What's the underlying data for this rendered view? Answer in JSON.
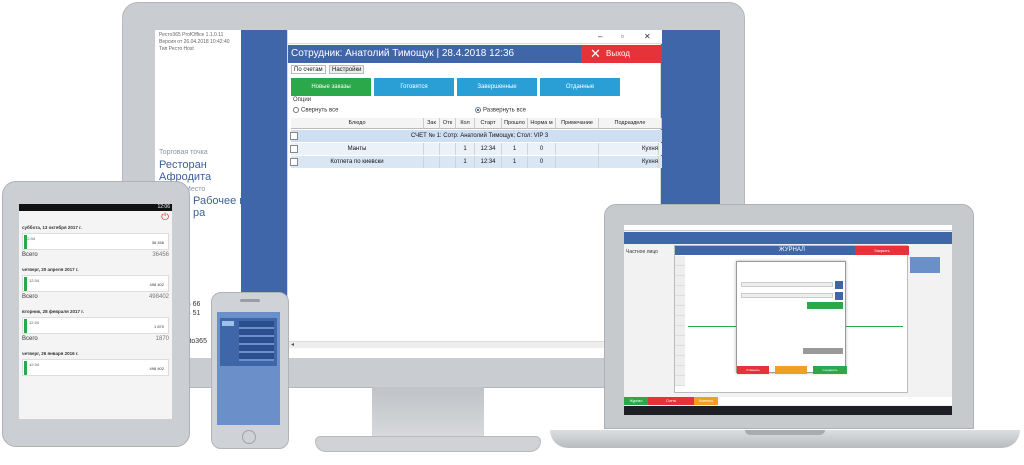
{
  "monitor": {
    "info_lines": [
      "Ресто365 ProfOffice 1.1.0.11",
      "Версия от 26.04.2018 10:42:40",
      "Тип Ресто Host"
    ],
    "store_label": "Торговая точка",
    "store_name_1": "Ресторан",
    "store_name_2": "Афродита",
    "place_label": "Место",
    "place_text": "Рабочее место",
    "place_text2": "ра",
    "phones": [
      "1 26 66",
      "0 84 51"
    ],
    "site": "Resto365",
    "app": {
      "header": "Сотрудник: Анатолий Тимощук | 28.4.2018 12:36",
      "exit_label": "Выход",
      "tabs": [
        "По счетам",
        "Настройки"
      ],
      "order_buttons": [
        {
          "label": "Новые заказы",
          "color": "#2ba84a"
        },
        {
          "label": "Готовятся",
          "color": "#2a9fd6"
        },
        {
          "label": "Завершенные",
          "color": "#2a9fd6"
        },
        {
          "label": "Отданные",
          "color": "#2a9fd6"
        }
      ],
      "options_label": "Опции",
      "collapse_all": "Свернуть все",
      "expand_all": "Развернуть все",
      "columns": [
        "Блюдо",
        "Зак",
        "Отк",
        "Кол",
        "Старт",
        "Прошло",
        "Норма м",
        "Примечание",
        "Подразделе"
      ],
      "group_row": "СЧЕТ № 1: Сотр: Анатолий Тимощук; Стол: VIP 3",
      "rows": [
        {
          "dish": "Манты",
          "qty": "1",
          "start": "12:34",
          "elapsed": "1",
          "norm": "0",
          "dept": "Кухня"
        },
        {
          "dish": "Котлета по киевски",
          "qty": "1",
          "start": "12:34",
          "elapsed": "1",
          "norm": "0",
          "dept": "Кухня"
        }
      ]
    }
  },
  "tablet": {
    "status_time": "12:06",
    "groups": [
      {
        "date": "суббота, 13 октября 2017 г.",
        "card_time": "12:34",
        "card_amount": "36 456",
        "total_label": "Всего",
        "total": "36456"
      },
      {
        "date": "четверг, 20 апреля 2017 г.",
        "card_time": "12:34",
        "card_amount": "498 402",
        "total_label": "Всего",
        "total": "498402"
      },
      {
        "date": "вторник, 28 февраля 2017 г.",
        "card_time": "12:34",
        "card_amount": "1 870",
        "total_label": "Всего",
        "total": "1870"
      },
      {
        "date": "четверг, 26 января 2016 г.",
        "card_time": "12:34",
        "card_amount": "498 402",
        "total_label": "",
        "total": ""
      }
    ]
  },
  "laptop": {
    "title": "ЖУРНАЛ",
    "client_label": "Частное лицо",
    "cancel_btn": "Отменить",
    "close_btn": "Закрыть",
    "save_btn": "Сохранить",
    "pay_label": "Оплатить",
    "bottom_tabs": [
      {
        "label": "Журнал",
        "color": "#2ba84a"
      },
      {
        "label": "Счета",
        "color": "#e4343a"
      },
      {
        "label": "Клиенты",
        "color": "#f0a020"
      }
    ]
  }
}
